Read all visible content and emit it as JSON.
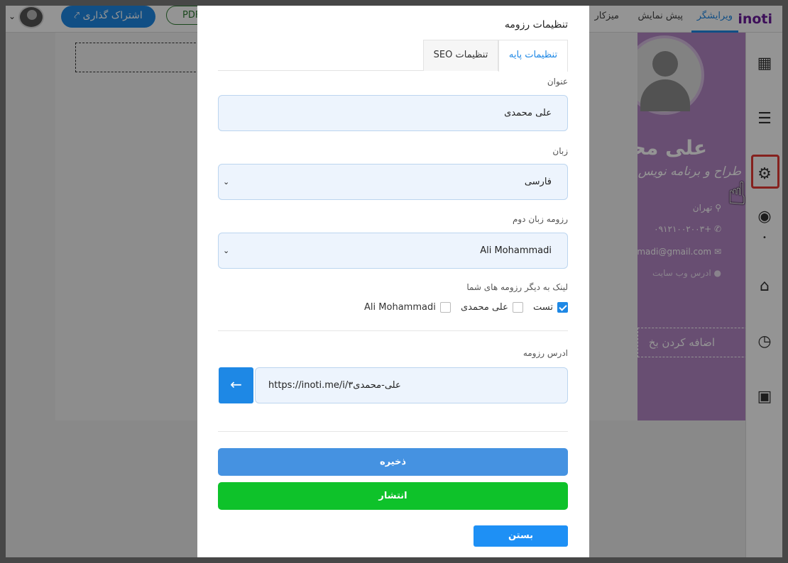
{
  "topbar": {
    "logo": "inoti",
    "nav_editor": "ویرایشگر",
    "nav_preview": "پیش نمایش",
    "nav_desk": "میزکار",
    "share_label": "اشتراک گذاری",
    "pdf_label": "PDF"
  },
  "resume_preview": {
    "name": "علی محمد",
    "title": "طراح و برنامه نویس",
    "city": "تهران",
    "phone": "+۰۹۱۲۱۰۰۲۰۰۳",
    "email": "madi@gmail.com",
    "website": "ادرس وب سایت",
    "add_section": "اضافه کردن بخ"
  },
  "sidebar": {
    "icons": [
      "grid-icon",
      "sliders-icon",
      "gear-icon",
      "eye-icon",
      "building-icon",
      "history-icon",
      "save-icon"
    ],
    "active": "gear-icon"
  },
  "modal": {
    "title": "تنظیمات رزومه",
    "tabs": [
      "تنظیمات پایه",
      "تنظیمات SEO"
    ],
    "active_tab": "تنظیمات پایه",
    "title_label": "عنوان",
    "title_value": "علی محمدی",
    "language_label": "زبان",
    "language_value": "فارسی",
    "second_lang_label": "رزومه زبان دوم",
    "second_lang_value": "Ali Mohammadi",
    "links_label": "لینک به دیگر رزومه های شما",
    "links": [
      {
        "label": "تست",
        "checked": true
      },
      {
        "label": "علی محمدی",
        "checked": false
      },
      {
        "label": "Ali Mohammadi",
        "checked": false
      }
    ],
    "url_label": "ادرس رزومه",
    "url_value": "https://inoti.me/i/علی-محمدی۳",
    "save_label": "ذخیره",
    "publish_label": "انتشار",
    "close_label": "بستن"
  }
}
